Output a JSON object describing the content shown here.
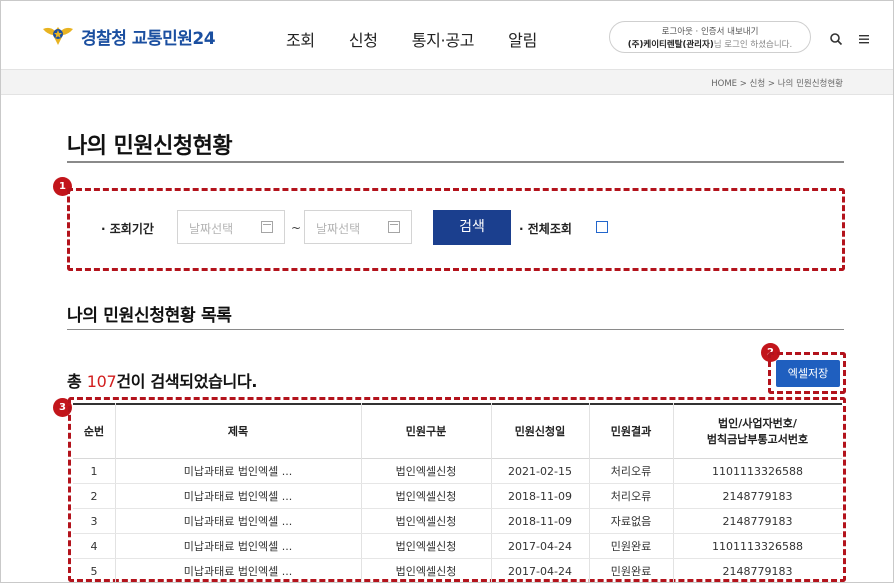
{
  "header": {
    "logo_text": "경찰청 교통민원24",
    "nav": [
      "조회",
      "신청",
      "통지·공고",
      "알림"
    ],
    "login_links": "로그아웃 · 인증서 내보내기",
    "login_user": "(주)케이티렌탈(관리자)",
    "login_suffix": "님 로그인 하셨습니다."
  },
  "breadcrumb": "HOME > 신청 > 나의 민원신청현황",
  "page_title": "나의 민원신청현황",
  "search": {
    "period_label": "· 조회기간",
    "date_from_placeholder": "날짜선택",
    "date_to_placeholder": "날짜선택",
    "tilde": "~",
    "search_button": "검색",
    "all_label": "· 전체조회",
    "all_checked": false
  },
  "list_title": "나의 민원신청현황 목록",
  "total": {
    "prefix": "총 ",
    "count": "107",
    "suffix": "건이 검색되었습니다."
  },
  "excel_button": "엑셀저장",
  "badges": [
    "1",
    "2",
    "3"
  ],
  "table": {
    "headers": [
      "순번",
      "제목",
      "민원구분",
      "민원신청일",
      "민원결과",
      "법인/사업자번호/\n범칙금납부통고서번호"
    ],
    "rows": [
      [
        "1",
        "미납과태료 법인엑셀 ...",
        "법인엑셀신청",
        "2021-02-15",
        "처리오류",
        "1101113326588"
      ],
      [
        "2",
        "미납과태료 법인엑셀 ...",
        "법인엑셀신청",
        "2018-11-09",
        "처리오류",
        "2148779183"
      ],
      [
        "3",
        "미납과태료 법인엑셀 ...",
        "법인엑셀신청",
        "2018-11-09",
        "자료없음",
        "2148779183"
      ],
      [
        "4",
        "미납과태료 법인엑셀 ...",
        "법인엑셀신청",
        "2017-04-24",
        "민원완료",
        "1101113326588"
      ],
      [
        "5",
        "미납과태료 법인엑셀 ...",
        "법인엑셀신청",
        "2017-04-24",
        "민원완료",
        "2148779183"
      ]
    ]
  },
  "colors": {
    "accent_blue": "#1b3f8e",
    "excel_blue": "#1f5fbf",
    "highlight_red": "#b3131c",
    "count_red": "#d21e1e"
  }
}
